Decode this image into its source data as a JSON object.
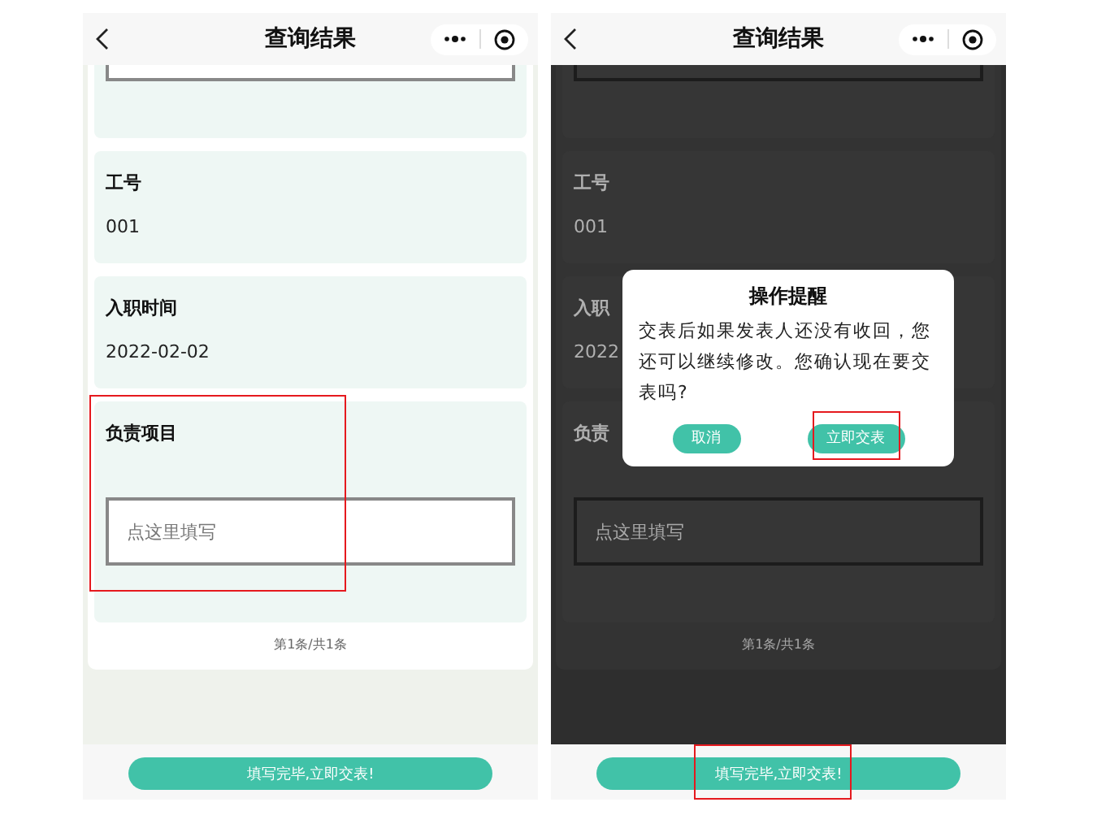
{
  "screens": [
    {
      "title": "查询结果",
      "dimmed": false,
      "fields": [
        {
          "kind": "text",
          "label": "工号",
          "value": "001"
        },
        {
          "kind": "text",
          "label": "入职时间",
          "value": "2022-02-02"
        },
        {
          "kind": "input",
          "label": "负责项目",
          "placeholder": "点这里填写",
          "highlighted": true
        }
      ],
      "pager": "第1条/共1条",
      "submit": {
        "label": "填写完毕,立即交表!",
        "highlighted": false
      }
    },
    {
      "title": "查询结果",
      "dimmed": true,
      "fields": [
        {
          "kind": "text",
          "label": "工号",
          "value": "001"
        },
        {
          "kind": "text",
          "label": "入职",
          "value": "2022"
        },
        {
          "kind": "input",
          "label": "负责",
          "placeholder": "点这里填写",
          "highlighted": false
        }
      ],
      "pager": "第1条/共1条",
      "submit": {
        "label": "填写完毕,立即交表!",
        "highlighted": true
      },
      "dialog": {
        "title": "操作提醒",
        "message": "交表后如果发表人还没有收回，您还可以继续修改。您确认现在要交表吗?",
        "buttons": [
          {
            "label": "取消",
            "highlighted": false
          },
          {
            "label": "立即交表",
            "highlighted": true
          }
        ]
      }
    }
  ]
}
